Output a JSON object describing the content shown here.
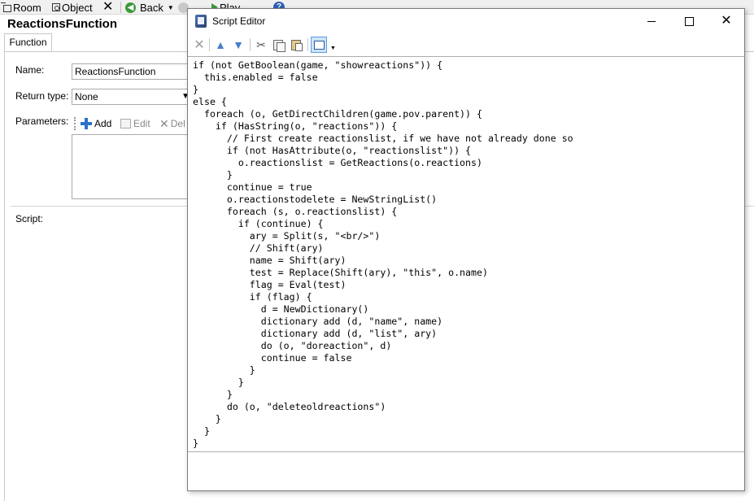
{
  "app_toolbar": {
    "room_label": "Room",
    "object_label": "Object",
    "back_label": "Back",
    "play_label": "Play"
  },
  "function": {
    "title": "ReactionsFunction",
    "tab_label": "Function",
    "name_label": "Name:",
    "name_value": "ReactionsFunction",
    "return_type_label": "Return type:",
    "return_type_value": "None",
    "parameters_label": "Parameters:",
    "params_add_label": "Add",
    "params_edit_label": "Edit",
    "params_delete_label": "Del",
    "script_label": "Script:"
  },
  "script_editor": {
    "title": "Script Editor",
    "code": "if (not GetBoolean(game, \"showreactions\")) {\n  this.enabled = false\n}\nelse {\n  foreach (o, GetDirectChildren(game.pov.parent)) {\n    if (HasString(o, \"reactions\")) {\n      // First create reactionslist, if we have not already done so\n      if (not HasAttribute(o, \"reactionslist\")) {\n        o.reactionslist = GetReactions(o.reactions)\n      }\n      continue = true\n      o.reactionstodelete = NewStringList()\n      foreach (s, o.reactionslist) {\n        if (continue) {\n          ary = Split(s, \"<br/>\")\n          // Shift(ary)\n          name = Shift(ary)\n          test = Replace(Shift(ary), \"this\", o.name)\n          flag = Eval(test)\n          if (flag) {\n            d = NewDictionary()\n            dictionary add (d, \"name\", name)\n            dictionary add (d, \"list\", ary)\n            do (o, \"doreaction\", d)\n            continue = false\n          }\n        }\n      }\n      do (o, \"deleteoldreactions\")\n    }\n  }\n}"
  },
  "icons": {
    "room": "room-icon",
    "object": "object-icon",
    "close": "close-icon",
    "back": "back-arrow-icon",
    "play": "play-icon",
    "help": "help-icon",
    "delete": "delete-icon",
    "move_up": "arrow-up-icon",
    "move_down": "arrow-down-icon",
    "cut": "scissors-icon",
    "copy": "copy-icon",
    "paste": "paste-icon",
    "code_view": "code-view-icon"
  },
  "colors": {
    "accent_blue": "#2a72c9",
    "back_green": "#3a9a3a",
    "toolbar_bg": "#f0f0f0"
  }
}
